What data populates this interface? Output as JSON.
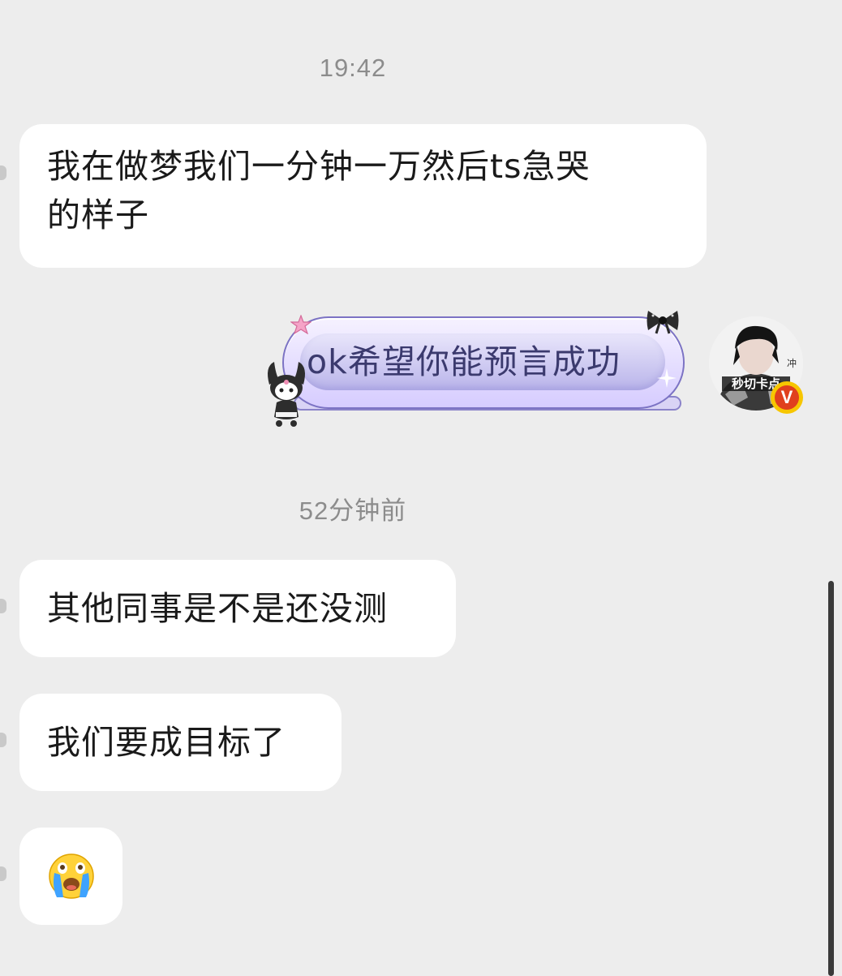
{
  "chat": {
    "timestamp_1": "19:42",
    "msg_1": "我在做梦我们一分钟一万然后ts急哭的样子",
    "msg_1_line1": "我在做梦我们一分钟一万然后ts急哭",
    "msg_1_line2": "的样子",
    "sent_msg": "ok希望你能预言成功",
    "timestamp_2": "52分钟前",
    "msg_2": "其他同事是不是还没测",
    "msg_3": "我们要成目标了",
    "msg_4_emoji": "crying-face",
    "avatar_badge": "V",
    "avatar_caption": "秒切卡点"
  },
  "colors": {
    "background": "#ededed",
    "bubble": "#ffffff",
    "sent_bubble_border": "#7c73c4",
    "sent_text": "#3b3a6e",
    "timestamp": "#8c8c8c",
    "badge_yellow": "#f7c600",
    "badge_red": "#e0401e"
  }
}
